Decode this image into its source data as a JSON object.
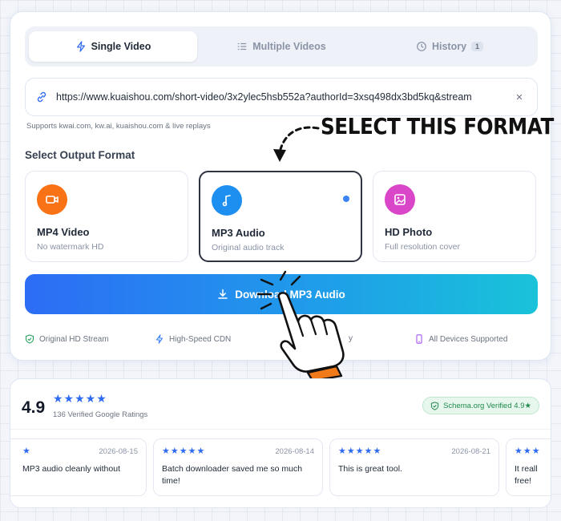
{
  "tabs": [
    {
      "label": "Single Video",
      "icon": "bolt-icon",
      "active": true
    },
    {
      "label": "Multiple Videos",
      "icon": "list-icon",
      "active": false
    },
    {
      "label": "History",
      "icon": "clock-icon",
      "active": false,
      "count": "1"
    }
  ],
  "url_input": {
    "value": "https://www.kuaishou.com/short-video/3x2ylec5hsb552a?authorId=3xsq498dx3bd5kq&stream",
    "clear_label": "×"
  },
  "supports_text": "Supports kwai.com, kw.ai, kuaishou.com & live replays",
  "section_title": "Select Output Format",
  "formats": [
    {
      "title": "MP4 Video",
      "subtitle": "No watermark HD",
      "icon": "video-camera-icon",
      "color": "#f97316",
      "selected": false
    },
    {
      "title": "MP3 Audio",
      "subtitle": "Original audio track",
      "icon": "music-note-icon",
      "color": "#1d8ff0",
      "selected": true
    },
    {
      "title": "HD Photo",
      "subtitle": "Full resolution cover",
      "icon": "image-icon",
      "color": "#d946c8",
      "selected": false
    }
  ],
  "download_button": {
    "label": "Download MP3 Audio",
    "icon": "download-icon"
  },
  "features": [
    {
      "label": "Original HD Stream",
      "icon": "shield-check-icon",
      "color": "#22a05a"
    },
    {
      "label": "High-Speed CDN",
      "icon": "bolt-icon",
      "color": "#3b82f6"
    },
    {
      "label": "y",
      "icon": "",
      "color": "#6b7280"
    },
    {
      "label": "All Devices Supported",
      "icon": "mobile-icon",
      "color": "#a855f7"
    }
  ],
  "annotation": {
    "text": "SELECT THIS FORMAT"
  },
  "reviews": {
    "rating": "4.9",
    "stars": "★★★★★",
    "count_text": "136 Verified Google Ratings",
    "verified_badge": "Schema.org Verified 4.9★",
    "items": [
      {
        "stars": "★",
        "date": "2026-08-15",
        "text": "MP3 audio cleanly without"
      },
      {
        "stars": "★★★★★",
        "date": "2026-08-14",
        "text": "Batch downloader saved me so much time!"
      },
      {
        "stars": "★★★★★",
        "date": "2026-08-21",
        "text": "This is great tool."
      },
      {
        "stars": "★★★",
        "date": "",
        "text": "It reall free!"
      }
    ]
  },
  "colors": {
    "accent": "#2f6bf0",
    "gradient_end": "#19c3d9",
    "hand_cuff": "#f07a1a"
  }
}
